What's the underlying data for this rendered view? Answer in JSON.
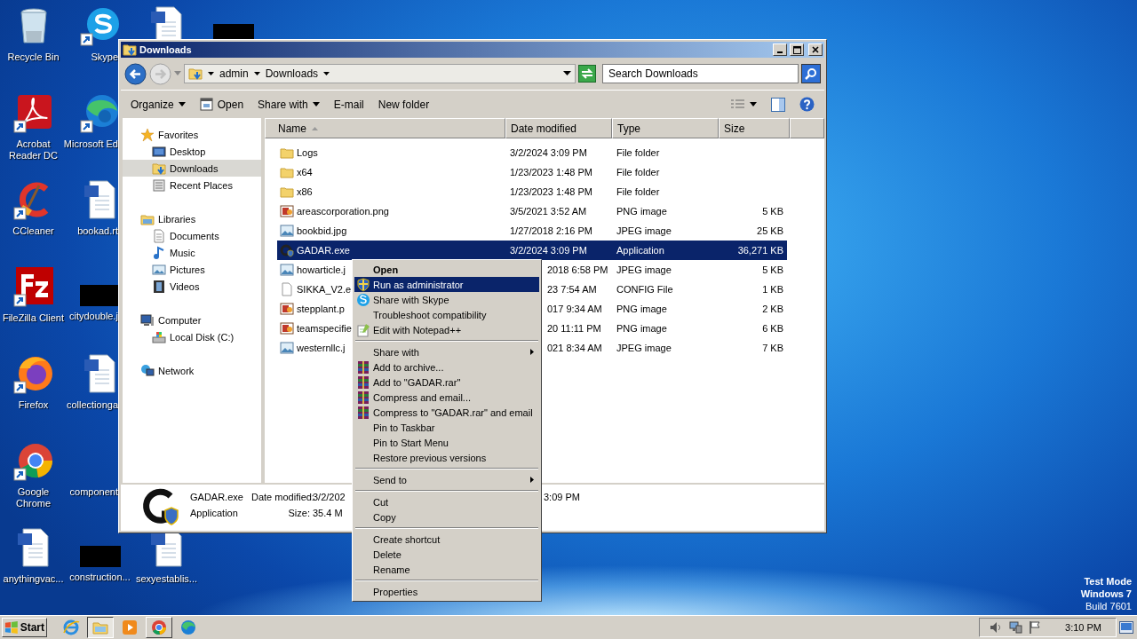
{
  "desktop": {
    "columns": [
      [
        {
          "kind": "recycle-bin",
          "label": "Recycle Bin",
          "shortcut": false
        },
        {
          "kind": "acrobat",
          "label": "Acrobat Reader DC",
          "shortcut": true
        },
        {
          "kind": "ccleaner",
          "label": "CCleaner",
          "shortcut": true
        },
        {
          "kind": "filezilla",
          "label": "FileZilla Client",
          "shortcut": true
        },
        {
          "kind": "firefox",
          "label": "Firefox",
          "shortcut": true
        },
        {
          "kind": "chrome",
          "label": "Google Chrome",
          "shortcut": true
        },
        {
          "kind": "document",
          "label": "anythingvac...",
          "shortcut": false
        }
      ],
      [
        {
          "kind": "skype",
          "label": "Skype",
          "shortcut": true
        },
        {
          "kind": "edge",
          "label": "Microsoft Ed",
          "shortcut": true
        },
        {
          "kind": "document",
          "label": "bookad.rt",
          "shortcut": false
        },
        {
          "kind": "redacted",
          "label": "citydouble.j"
        },
        {
          "kind": "document",
          "label": "collectionga",
          "shortcut": false
        },
        {
          "kind": "blank",
          "label": "component"
        },
        {
          "kind": "redacted",
          "label": "construction..."
        }
      ],
      [
        {
          "kind": "document",
          "shortcut": false
        },
        {
          "kind": "document",
          "label": "sexyestablis...",
          "shortcut": false
        }
      ],
      [
        {
          "kind": "redacted"
        }
      ]
    ]
  },
  "system_notice": [
    "Test Mode",
    "Windows 7",
    "Build 7601"
  ],
  "window": {
    "title": "Downloads",
    "address": {
      "crumbs": [
        "admin",
        "Downloads"
      ]
    },
    "search": {
      "placeholder": "Search Downloads"
    },
    "toolbar": [
      {
        "label": "Organize",
        "kind": "menu"
      },
      {
        "label": "Open",
        "kind": "open"
      },
      {
        "label": "Share with",
        "kind": "menu"
      },
      {
        "label": "E-mail",
        "kind": "plain"
      },
      {
        "label": "New folder",
        "kind": "plain"
      }
    ],
    "nav": [
      {
        "label": "Favorites",
        "selected": false,
        "children": [
          {
            "label": "Desktop",
            "selected": false
          },
          {
            "label": "Downloads",
            "selected": true
          },
          {
            "label": "Recent Places",
            "selected": false
          }
        ]
      },
      {
        "label": "Libraries",
        "selected": false,
        "children": [
          {
            "label": "Documents",
            "selected": false
          },
          {
            "label": "Music",
            "selected": false
          },
          {
            "label": "Pictures",
            "selected": false
          },
          {
            "label": "Videos",
            "selected": false
          }
        ]
      },
      {
        "label": "Computer",
        "selected": false,
        "children": [
          {
            "label": "Local Disk (C:)",
            "selected": false
          }
        ]
      },
      {
        "label": "Network",
        "selected": false
      }
    ],
    "columns": [
      {
        "label": "Name",
        "sorted": true
      },
      {
        "label": "Date modified",
        "sorted": false
      },
      {
        "label": "Type",
        "sorted": false
      },
      {
        "label": "Size",
        "sorted": false
      }
    ],
    "files": [
      {
        "kind": "folder",
        "name": "Logs",
        "date": "3/2/2024 3:09 PM",
        "type": "File folder",
        "selected": false,
        "under_menu": false
      },
      {
        "kind": "folder",
        "name": "x64",
        "date": "1/23/2023 1:48 PM",
        "type": "File folder",
        "selected": false,
        "under_menu": false
      },
      {
        "kind": "folder",
        "name": "x86",
        "date": "1/23/2023 1:48 PM",
        "type": "File folder",
        "selected": false,
        "under_menu": false
      },
      {
        "kind": "png",
        "name": "areascorporation.png",
        "date": "3/5/2021 3:52 AM",
        "type": "PNG image",
        "size": "5 KB",
        "selected": false,
        "under_menu": false
      },
      {
        "kind": "jpeg",
        "name": "bookbid.jpg",
        "date": "1/27/2018 2:16 PM",
        "type": "JPEG image",
        "size": "25 KB",
        "selected": false,
        "under_menu": false
      },
      {
        "kind": "exe",
        "name": "GADAR.exe",
        "date": "3/2/2024 3:09 PM",
        "type": "Application",
        "size": "36,271 KB",
        "selected": true,
        "under_menu": false
      },
      {
        "kind": "jpeg",
        "name": "howarticle.j",
        "date": "2018 6:58 PM",
        "type": "JPEG image",
        "size": "5 KB",
        "selected": false,
        "under_menu": true
      },
      {
        "kind": "config",
        "name": "SIKKA_V2.e",
        "date": "23 7:54 AM",
        "type": "CONFIG File",
        "size": "1 KB",
        "selected": false,
        "under_menu": true
      },
      {
        "kind": "png",
        "name": "stepplant.p",
        "date": "017 9:34 AM",
        "type": "PNG image",
        "size": "2 KB",
        "selected": false,
        "under_menu": true
      },
      {
        "kind": "png",
        "name": "teamspecifie",
        "date": "20 11:11 PM",
        "type": "PNG image",
        "size": "6 KB",
        "selected": false,
        "under_menu": true
      },
      {
        "kind": "jpeg",
        "name": "westernllc.j",
        "date": "021 8:34 AM",
        "type": "JPEG image",
        "size": "7 KB",
        "selected": false,
        "under_menu": true
      }
    ],
    "details": {
      "name": "GADAR.exe",
      "type": "Application",
      "fields": [
        {
          "label": "Date modified:",
          "value": "3/2/202",
          "value_continued": "3:09 PM"
        },
        {
          "label": "Size:",
          "value": "35.4 M"
        }
      ]
    }
  },
  "context_menu": {
    "items": [
      {
        "kind": "item",
        "label": "Open",
        "default": true,
        "highlighted": false
      },
      {
        "kind": "item",
        "label": "Run as administrator",
        "default": false,
        "highlighted": true
      },
      {
        "kind": "item",
        "label": "Share with Skype",
        "default": false,
        "highlighted": false
      },
      {
        "kind": "item",
        "label": "Troubleshoot compatibility",
        "default": false,
        "highlighted": false
      },
      {
        "kind": "item",
        "label": "Edit with Notepad++",
        "default": false,
        "highlighted": false
      },
      {
        "kind": "separator"
      },
      {
        "kind": "submenu",
        "label": "Share with",
        "default": false,
        "highlighted": false
      },
      {
        "kind": "item",
        "label": "Add to archive...",
        "default": false,
        "highlighted": false
      },
      {
        "kind": "item",
        "label": "Add to \"GADAR.rar\"",
        "default": false,
        "highlighted": false
      },
      {
        "kind": "item",
        "label": "Compress and email...",
        "default": false,
        "highlighted": false
      },
      {
        "kind": "item",
        "label": "Compress to \"GADAR.rar\" and email",
        "default": false,
        "highlighted": false
      },
      {
        "kind": "item",
        "label": "Pin to Taskbar",
        "default": false,
        "highlighted": false
      },
      {
        "kind": "item",
        "label": "Pin to Start Menu",
        "default": false,
        "highlighted": false
      },
      {
        "kind": "item",
        "label": "Restore previous versions",
        "default": false,
        "highlighted": false
      },
      {
        "kind": "separator"
      },
      {
        "kind": "submenu",
        "label": "Send to",
        "default": false,
        "highlighted": false
      },
      {
        "kind": "separator"
      },
      {
        "kind": "item",
        "label": "Cut",
        "default": false,
        "highlighted": false
      },
      {
        "kind": "item",
        "label": "Copy",
        "default": false,
        "highlighted": false
      },
      {
        "kind": "separator"
      },
      {
        "kind": "item",
        "label": "Create shortcut",
        "default": false,
        "highlighted": false
      },
      {
        "kind": "item",
        "label": "Delete",
        "default": false,
        "highlighted": false
      },
      {
        "kind": "item",
        "label": "Rename",
        "default": false,
        "highlighted": false
      },
      {
        "kind": "separator"
      },
      {
        "kind": "item",
        "label": "Properties",
        "default": false,
        "highlighted": false
      }
    ]
  },
  "taskbar": {
    "start": "Start",
    "apps": [
      {
        "kind": "ie",
        "active": false,
        "running": false
      },
      {
        "kind": "explorer",
        "active": true,
        "running": true
      },
      {
        "kind": "media-player",
        "active": false,
        "running": false
      },
      {
        "kind": "chrome",
        "active": false,
        "running": true
      },
      {
        "kind": "edge",
        "active": false,
        "running": false
      }
    ],
    "clock": "3:10 PM"
  }
}
